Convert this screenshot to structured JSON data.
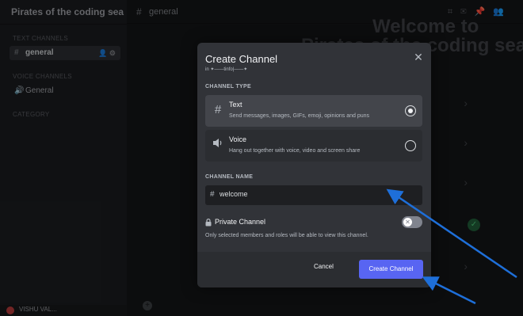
{
  "sidebar": {
    "server_title": "Pirates of the coding sea",
    "category_1": "TEXT CHANNELS",
    "channels": [
      {
        "name": "general"
      }
    ],
    "category_2": "VOICE CHANNELS",
    "voice_channel": "General",
    "category_3": "CATEGORY",
    "user_name": "VISHU VAL..."
  },
  "header": {
    "channel_name": "general"
  },
  "main": {
    "welcome_line_1": "Welcome to",
    "welcome_line_2": "Pirates of the coding sea"
  },
  "modal": {
    "title": "Create Channel",
    "subtitle": "in ✦——tinfo|——✦",
    "channel_type_label": "CHANNEL TYPE",
    "types": [
      {
        "name": "Text",
        "description": "Send messages, images, GIFs, emoji, opinions and puns",
        "selected": true,
        "icon": "hash-icon"
      },
      {
        "name": "Voice",
        "description": "Hang out together with voice, video and screen share",
        "selected": false,
        "icon": "speaker-icon"
      }
    ],
    "channel_name_label": "CHANNEL NAME",
    "channel_name_value": "welcome",
    "private_label": "Private Channel",
    "private_desc": "Only selected members and roles will be able to view this channel.",
    "private_enabled": false,
    "cancel_label": "Cancel",
    "create_label": "Create Channel"
  },
  "colors": {
    "accent": "#5865f2",
    "modal_bg": "#313338",
    "annotation_arrow": "#1e6fd9"
  }
}
